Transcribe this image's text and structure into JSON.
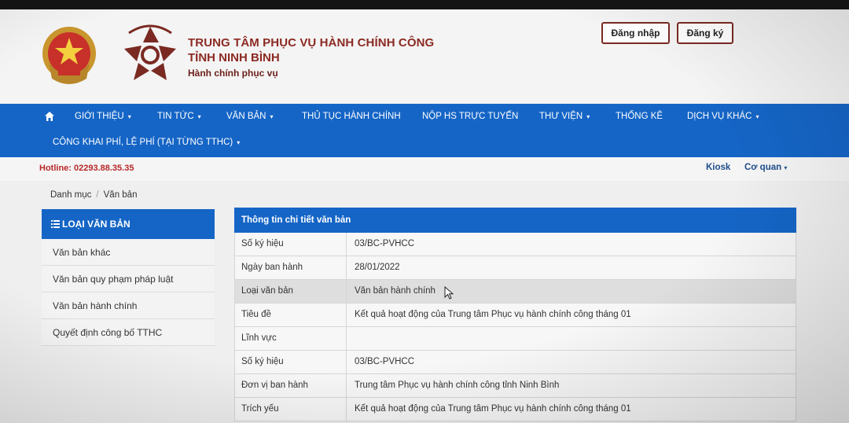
{
  "header": {
    "org_line1": "TRUNG TÂM PHỤC VỤ HÀNH CHÍNH CÔNG",
    "org_line2": "TỈNH NINH BÌNH",
    "slogan": "Hành chính phục vụ",
    "login_label": "Đăng nhập",
    "register_label": "Đăng ký"
  },
  "nav": {
    "items": [
      {
        "label": "GIỚI THIỆU",
        "caret": "▾"
      },
      {
        "label": "TIN TỨC",
        "caret": "▾"
      },
      {
        "label": "VĂN BẢN",
        "caret": "▾"
      },
      {
        "label": "THỦ TỤC HÀNH CHÍNH",
        "caret": ""
      },
      {
        "label": "NỘP HS TRỰC TUYẾN",
        "caret": ""
      },
      {
        "label": "THƯ VIỆN",
        "caret": "▾"
      },
      {
        "label": "THỐNG KÊ",
        "caret": ""
      },
      {
        "label": "DỊCH VỤ KHÁC",
        "caret": "▾"
      },
      {
        "label": "CÔNG KHAI PHÍ, LỆ PHÍ (TẠI TỪNG TTHC)",
        "caret": "▾"
      }
    ]
  },
  "infobar": {
    "hotline": "Hotline: 02293.88.35.35",
    "kiosk": "Kiosk",
    "coquan": "Cơ quan",
    "coquan_caret": "▾"
  },
  "breadcrumb": {
    "items": [
      "Danh mục",
      "Văn bản"
    ],
    "separator": "/"
  },
  "sidebar": {
    "title": "LOẠI VĂN BẢN",
    "items": [
      "Văn bản khác",
      "Văn bản quy phạm pháp luật",
      "Văn bản hành chính",
      "Quyết định công bố TTHC"
    ]
  },
  "detail": {
    "title": "Thông tin chi tiết văn bản",
    "rows": [
      {
        "label": "Số ký hiệu",
        "value": "03/BC-PVHCC"
      },
      {
        "label": "Ngày ban hành",
        "value": "28/01/2022"
      },
      {
        "label": "Loại văn bản",
        "value": "Văn bản hành chính"
      },
      {
        "label": "Tiêu đề",
        "value": "Kết quả hoạt động của Trung tâm Phục vụ hành chính công tháng 01"
      },
      {
        "label": "Lĩnh vực",
        "value": ""
      },
      {
        "label": "Số ký hiệu",
        "value": "03/BC-PVHCC"
      },
      {
        "label": "Đơn vị ban hành",
        "value": "Trung tâm Phục vụ hành chính công tỉnh Ninh Bình"
      },
      {
        "label": "Trích yếu",
        "value": "Kết quả hoạt động của Trung tâm Phục vụ hành chính công tháng 01"
      }
    ]
  },
  "colors": {
    "nav_blue": "#1565c6",
    "brand_red": "#8c2a23",
    "hotline_red": "#b8282a",
    "link_blue": "#1f4e8c"
  },
  "icons": {
    "home": "home-icon",
    "list": "list-icon",
    "emblem": "national-emblem-icon",
    "logo": "service-center-logo-icon",
    "cursor": "mouse-pointer-icon"
  }
}
